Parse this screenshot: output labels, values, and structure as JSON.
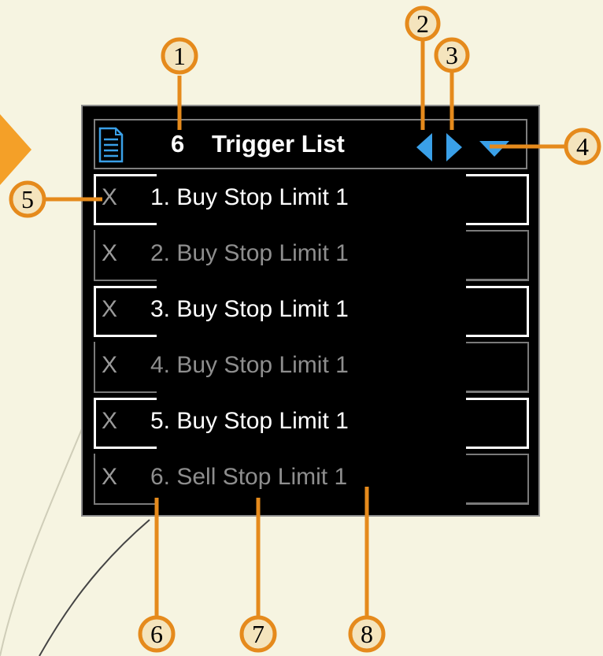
{
  "header": {
    "count": "6",
    "title": "Trigger List"
  },
  "triggers": [
    {
      "label": "1. Buy Stop Limit  1",
      "delete": "X",
      "state": "active"
    },
    {
      "label": "2. Buy Stop Limit  1",
      "delete": "X",
      "state": "inactive"
    },
    {
      "label": "3. Buy Stop Limit  1",
      "delete": "X",
      "state": "active"
    },
    {
      "label": "4. Buy Stop Limit  1",
      "delete": "X",
      "state": "inactive"
    },
    {
      "label": "5. Buy Stop Limit  1",
      "delete": "X",
      "state": "active"
    },
    {
      "label": "6. Sell Stop Limit  1",
      "delete": "X",
      "state": "inactive"
    }
  ],
  "callouts": [
    "1",
    "2",
    "3",
    "4",
    "5",
    "6",
    "7",
    "8"
  ],
  "colors": {
    "callout_line": "#e58a1c",
    "accent_blue": "#3aa0e8",
    "panel_bg": "#000000",
    "page_bg": "#f6f4e1"
  },
  "icons": {
    "list": "document-list-icon",
    "prev": "triangle-left-icon",
    "next": "triangle-right-icon",
    "dropdown": "triangle-down-icon"
  }
}
